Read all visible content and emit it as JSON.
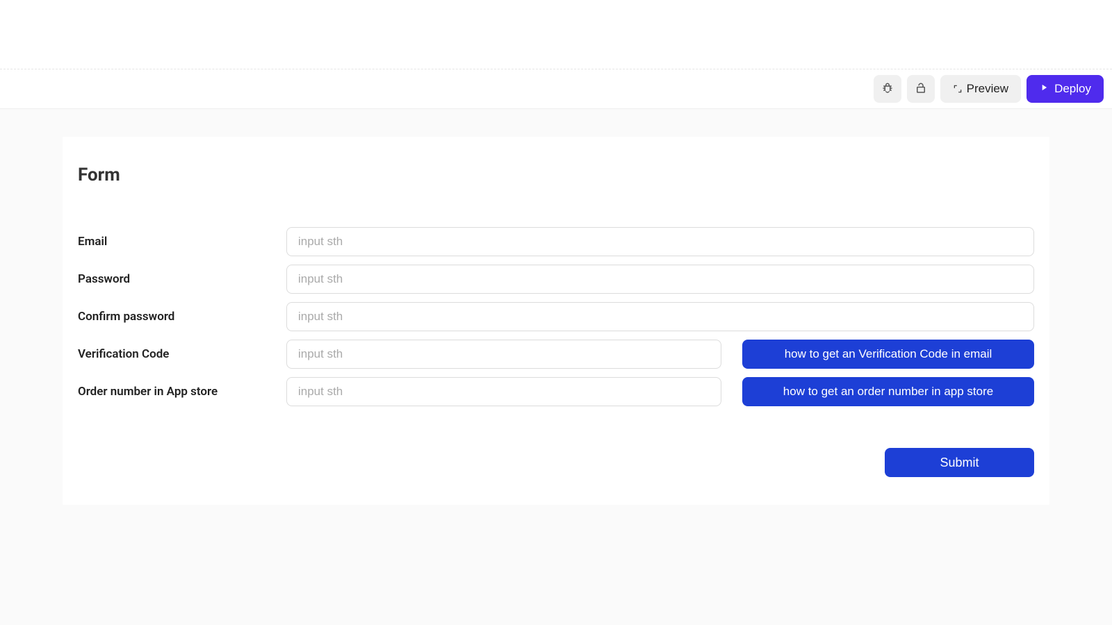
{
  "toolbar": {
    "preview_label": "Preview",
    "deploy_label": "Deploy"
  },
  "form": {
    "title": "Form",
    "fields": {
      "email": {
        "label": "Email",
        "placeholder": "input sth"
      },
      "password": {
        "label": "Password",
        "placeholder": "input sth"
      },
      "confirm_password": {
        "label": "Confirm password",
        "placeholder": "input sth"
      },
      "verification_code": {
        "label": "Verification Code",
        "placeholder": "input sth",
        "help_label": "how to get an Verification Code in email"
      },
      "order_number": {
        "label": "Order number in App store",
        "placeholder": "input sth",
        "help_label": "how to get an order number in app store"
      }
    },
    "submit_label": "Submit"
  }
}
